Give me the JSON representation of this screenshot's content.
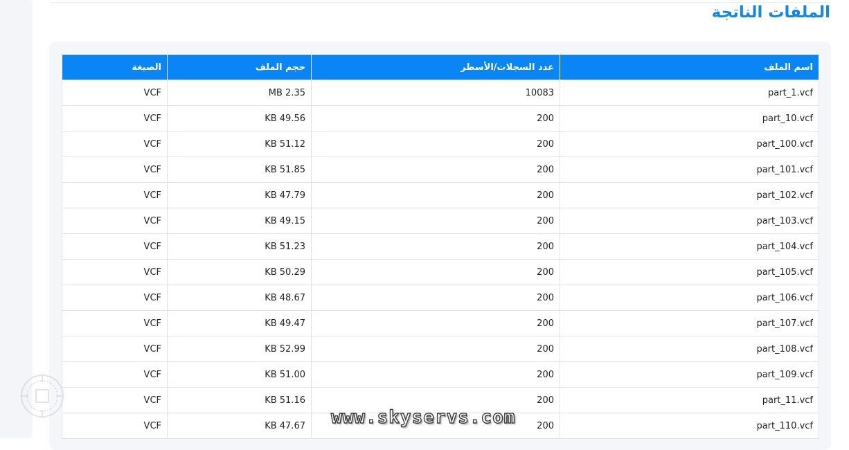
{
  "page_title": "الملفات الناتجة",
  "table": {
    "headers": {
      "file_name": "اسم الملف",
      "records": "عدد السجلات/الأسطر",
      "size": "حجم الملف",
      "format": "الصيغة"
    },
    "rows": [
      {
        "file_name": "part_1.vcf",
        "records": "10083",
        "size": "MB 2.35",
        "format": "VCF"
      },
      {
        "file_name": "part_10.vcf",
        "records": "200",
        "size": "KB 49.56",
        "format": "VCF"
      },
      {
        "file_name": "part_100.vcf",
        "records": "200",
        "size": "KB 51.12",
        "format": "VCF"
      },
      {
        "file_name": "part_101.vcf",
        "records": "200",
        "size": "KB 51.85",
        "format": "VCF"
      },
      {
        "file_name": "part_102.vcf",
        "records": "200",
        "size": "KB 47.79",
        "format": "VCF"
      },
      {
        "file_name": "part_103.vcf",
        "records": "200",
        "size": "KB 49.15",
        "format": "VCF"
      },
      {
        "file_name": "part_104.vcf",
        "records": "200",
        "size": "KB 51.23",
        "format": "VCF"
      },
      {
        "file_name": "part_105.vcf",
        "records": "200",
        "size": "KB 50.29",
        "format": "VCF"
      },
      {
        "file_name": "part_106.vcf",
        "records": "200",
        "size": "KB 48.67",
        "format": "VCF"
      },
      {
        "file_name": "part_107.vcf",
        "records": "200",
        "size": "KB 49.47",
        "format": "VCF"
      },
      {
        "file_name": "part_108.vcf",
        "records": "200",
        "size": "KB 52.99",
        "format": "VCF"
      },
      {
        "file_name": "part_109.vcf",
        "records": "200",
        "size": "KB 51.00",
        "format": "VCF"
      },
      {
        "file_name": "part_11.vcf",
        "records": "200",
        "size": "KB 51.16",
        "format": "VCF"
      },
      {
        "file_name": "part_110.vcf",
        "records": "200",
        "size": "KB 47.67",
        "format": "VCF"
      }
    ]
  },
  "watermark": {
    "text": "www.skyservs.com",
    "logo_icon": "compass-seal-icon"
  },
  "colors": {
    "accent": "#0a85f5",
    "title": "#1087ea"
  }
}
